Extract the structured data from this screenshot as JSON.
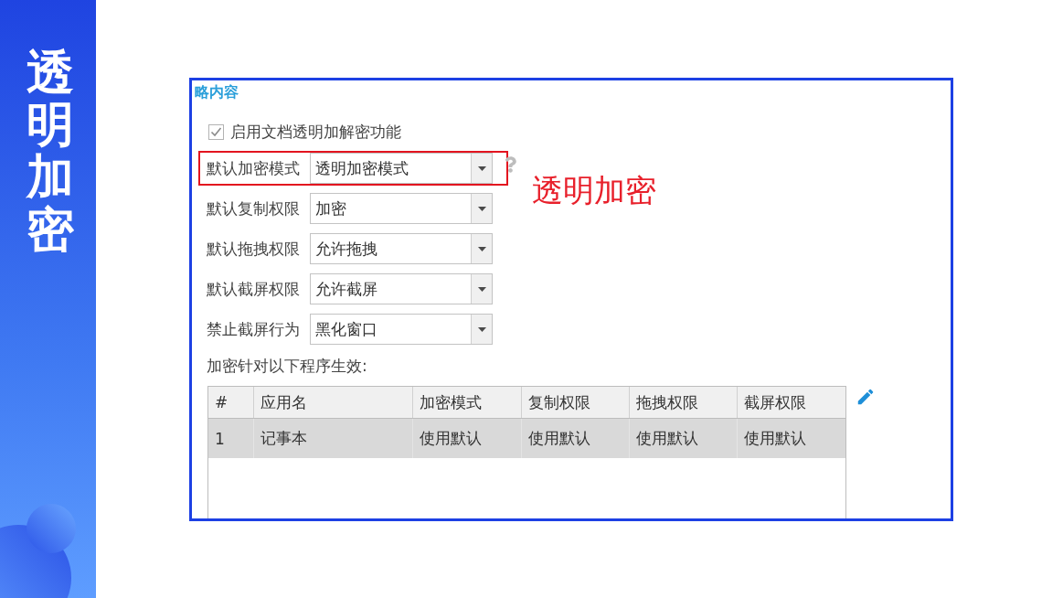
{
  "sidebar": {
    "title": "透明加密"
  },
  "panel": {
    "section_title": "略内容",
    "enable_checkbox": {
      "label": "启用文档透明加解密功能",
      "checked": true
    },
    "fields": [
      {
        "label": "默认加密模式",
        "value": "透明加密模式",
        "highlighted": true,
        "help_icon": true,
        "annotation": "透明加密"
      },
      {
        "label": "默认复制权限",
        "value": "加密",
        "highlighted": false,
        "help_icon": false
      },
      {
        "label": "默认拖拽权限",
        "value": "允许拖拽",
        "highlighted": false,
        "help_icon": false
      },
      {
        "label": "默认截屏权限",
        "value": "允许截屏",
        "highlighted": false,
        "help_icon": false
      },
      {
        "label": "禁止截屏行为",
        "value": "黑化窗口",
        "highlighted": false,
        "help_icon": false
      }
    ],
    "table_caption": "加密针对以下程序生效:",
    "table": {
      "columns": [
        "#",
        "应用名",
        "加密模式",
        "复制权限",
        "拖拽权限",
        "截屏权限"
      ],
      "rows": [
        {
          "cells": [
            "1",
            "记事本",
            "使用默认",
            "使用默认",
            "使用默认",
            "使用默认"
          ],
          "selected": true
        }
      ]
    }
  }
}
